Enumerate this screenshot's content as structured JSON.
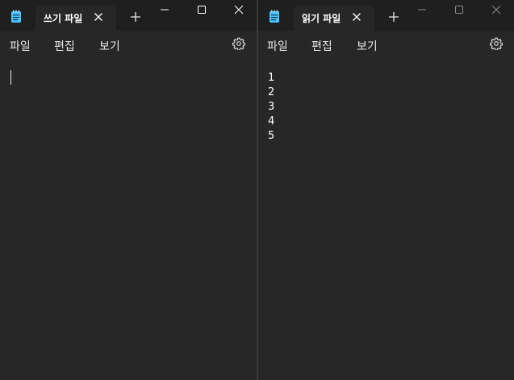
{
  "colors": {
    "window_bg": "#272727",
    "titlebar_bg": "#1f1f1f",
    "text": "#ffffff",
    "menu_text": "#e8e8e8",
    "icon_accent": "#4cc2ff"
  },
  "left_window": {
    "tab_title": "쓰기 파일",
    "menu": [
      "파일",
      "편집",
      "보기"
    ],
    "icons": [
      "notepad-icon",
      "close-icon",
      "plus-icon",
      "minimize-icon",
      "maximize-icon",
      "close-window-icon",
      "gear-icon"
    ],
    "content": ""
  },
  "right_window": {
    "tab_title": "읽기 파일",
    "menu": [
      "파일",
      "편집",
      "보기"
    ],
    "icons": [
      "notepad-icon",
      "close-icon",
      "plus-icon",
      "minimize-icon",
      "maximize-icon",
      "close-window-icon",
      "gear-icon"
    ],
    "lines": [
      "1",
      "2",
      "3",
      "4",
      "5"
    ]
  }
}
